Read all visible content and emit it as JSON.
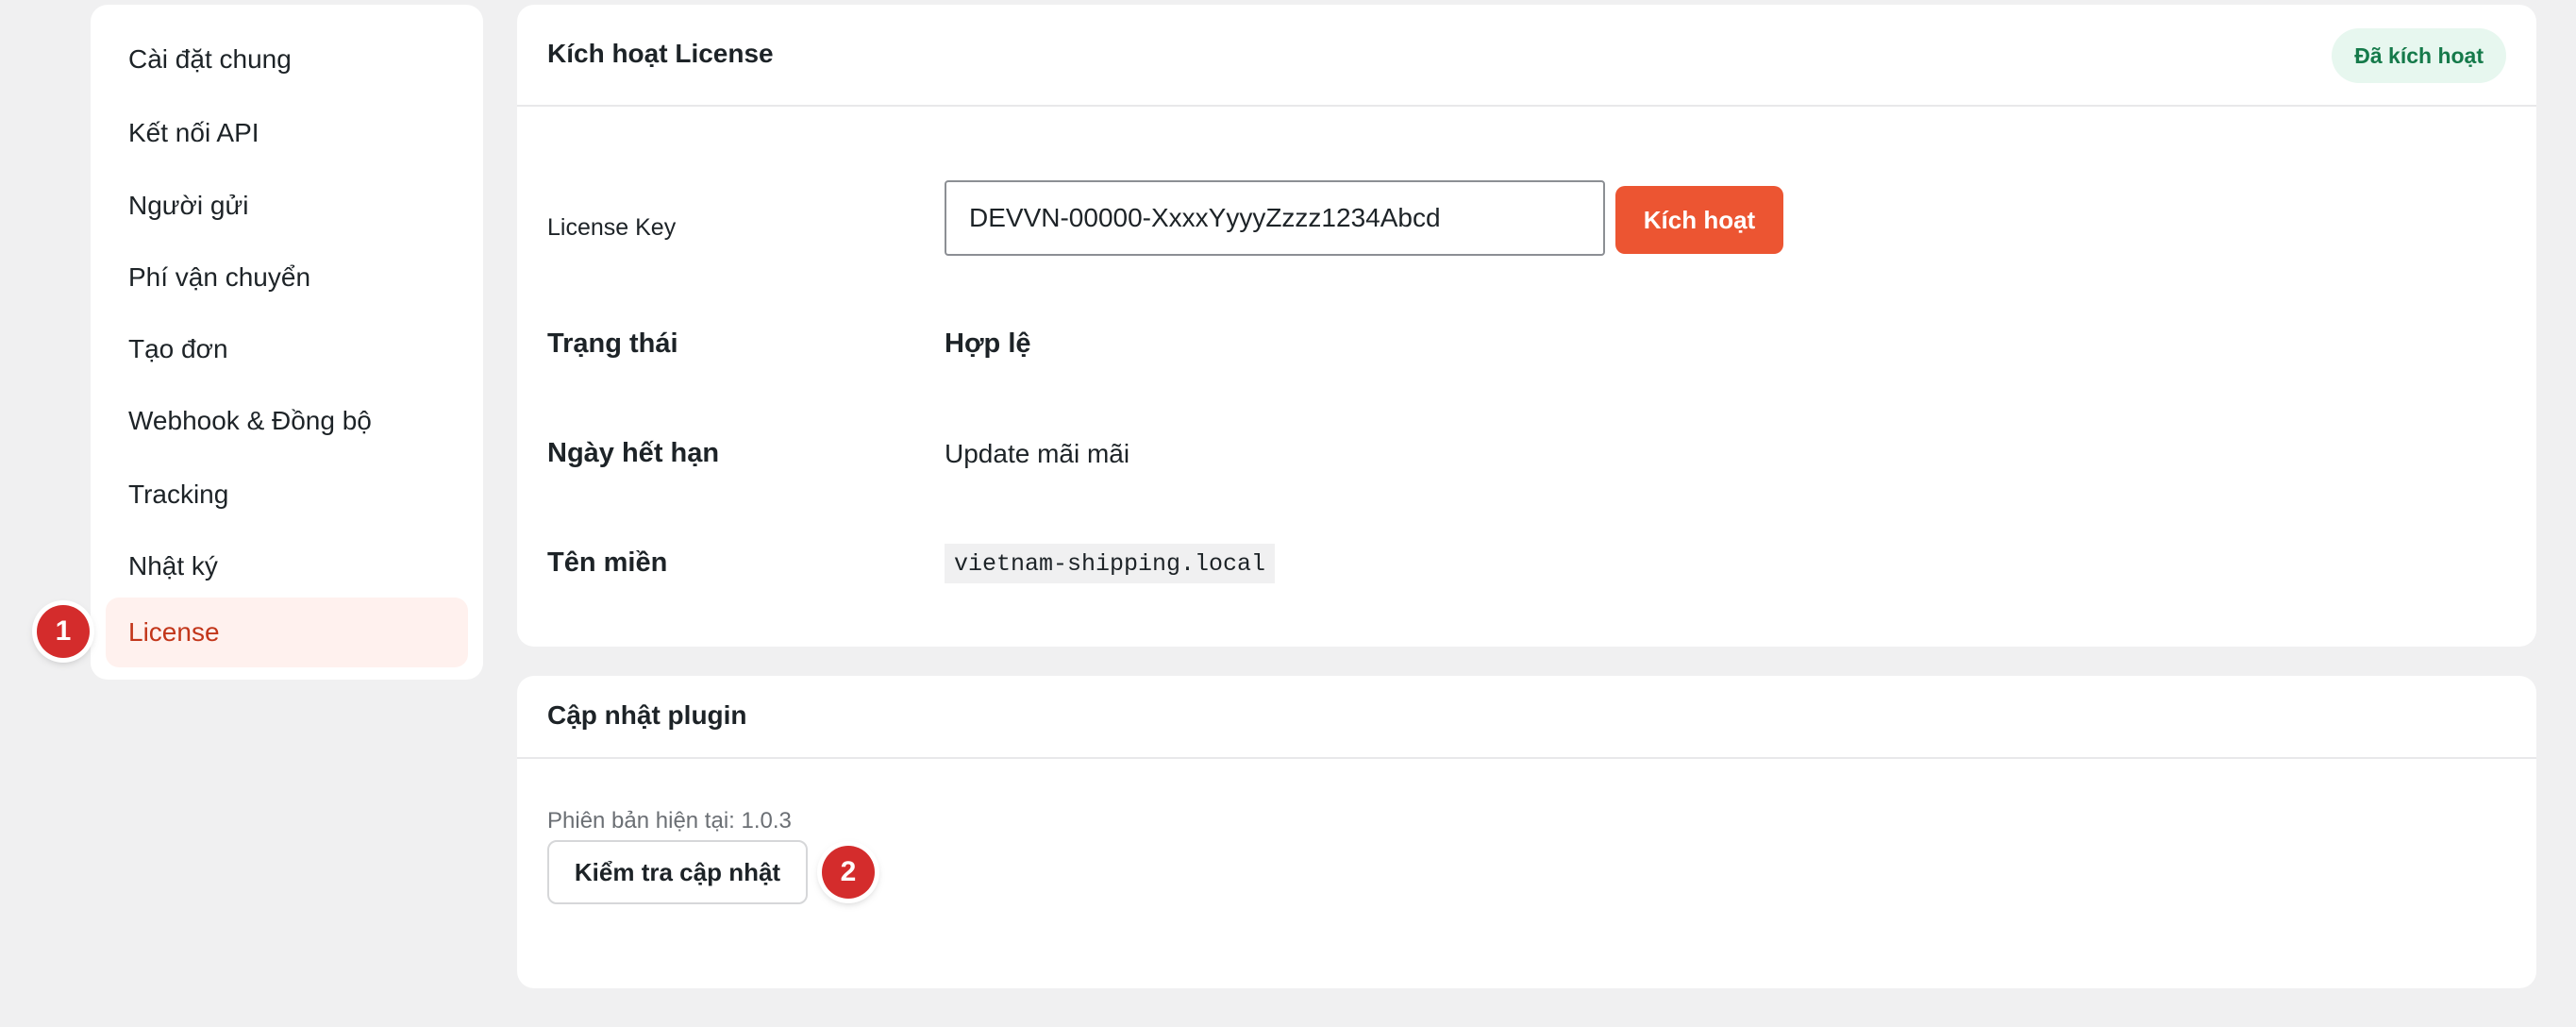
{
  "sidebar": {
    "items": [
      {
        "label": "Cài đặt chung",
        "active": false
      },
      {
        "label": "Kết nối API",
        "active": false
      },
      {
        "label": "Người gửi",
        "active": false
      },
      {
        "label": "Phí vận chuyển",
        "active": false
      },
      {
        "label": "Tạo đơn",
        "active": false
      },
      {
        "label": "Webhook & Đồng bộ",
        "active": false
      },
      {
        "label": "Tracking",
        "active": false
      },
      {
        "label": "Nhật ký",
        "active": false
      },
      {
        "label": "License",
        "active": true
      }
    ]
  },
  "markers": {
    "first": "1",
    "second": "2"
  },
  "license_card": {
    "title": "Kích hoạt License",
    "status_badge": "Đã kích hoạt",
    "license_key_label": "License Key",
    "license_key_value": "DEVVN-00000-XxxxYyyyZzzz1234Abcd",
    "activate_button": "Kích hoạt",
    "status_label": "Trạng thái",
    "status_value": "Hợp lệ",
    "expiry_label": "Ngày hết hạn",
    "expiry_value": "Update mãi mãi",
    "domain_label": "Tên miền",
    "domain_value": "vietnam-shipping.local"
  },
  "update_card": {
    "title": "Cập nhật plugin",
    "current_version": "Phiên bản hiện tại: 1.0.3",
    "check_button": "Kiểm tra cập nhật"
  },
  "colors": {
    "accent": "#ec5532",
    "active_nav_bg": "#fff1ee",
    "active_nav_text": "#c2361a",
    "badge_bg": "#e7f7ef",
    "badge_text": "#157a4a",
    "marker": "#d42c2c",
    "page_bg": "#f0f0f1"
  }
}
